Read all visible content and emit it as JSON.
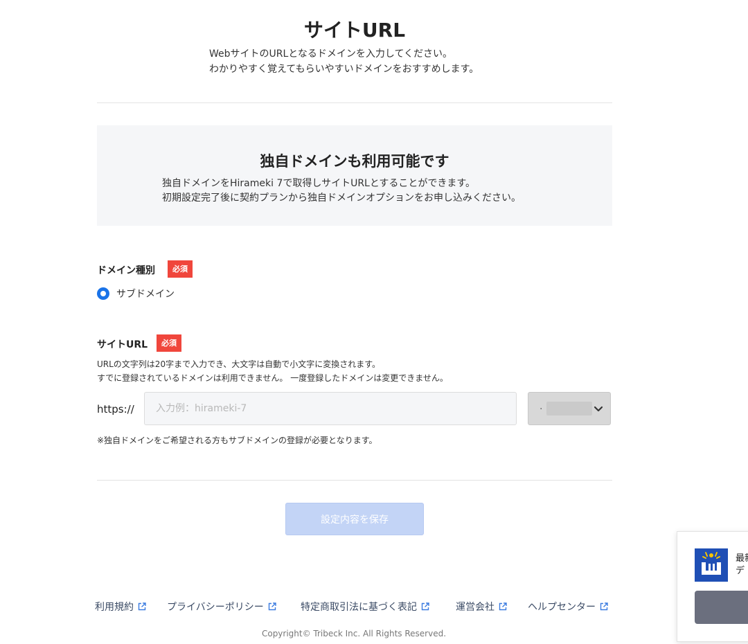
{
  "page": {
    "title": "サイトURL",
    "intro_line1": "WebサイトのURLとなるドメインを入力してください。",
    "intro_line2": "わかりやすく覚えてもらいやすいドメインをおすすめします。"
  },
  "info_box": {
    "title": "独自ドメインも利用可能です",
    "line1": "独自ドメインをHirameki 7で取得しサイトURLとすることができます。",
    "line2": "初期設定完了後に契約プランから独自ドメインオプションをお申し込みください。"
  },
  "domain_type": {
    "label": "ドメイン種別",
    "required": "必須",
    "option": "サブドメイン"
  },
  "site_url": {
    "label": "サイトURL",
    "required": "必須",
    "help1": "URLの文字列は20字まで入力でき、大文字は自動で小文字に変換されます。",
    "help2": "すでに登録されているドメインは利用できません。 一度登録したドメインは変更できません。",
    "prefix": "https://",
    "placeholder": "入力例：hirameki-7",
    "value": "",
    "select_value": ".",
    "note": "※独自ドメインをご希望される方もサブドメインの登録が必要となります。"
  },
  "actions": {
    "save_label": "設定内容を保存"
  },
  "footer": {
    "links": [
      "利用規約",
      "プライバシーポリシー",
      "特定商取引法に基づく表記",
      "運営会社",
      "ヘルプセンター"
    ],
    "copyright": "Copyright© Tribeck Inc. All Rights Reserved."
  },
  "widget": {
    "text_line1": "最新",
    "text_line2": "デ"
  },
  "colors": {
    "required_badge": "#f0463c",
    "radio_accent": "#1a73e8",
    "save_button": "#c3d4f6",
    "info_box_bg": "#f5f6f8",
    "widget_logo": "#1f4fb5"
  },
  "icons": {
    "external_link": "external-link-icon",
    "select_chevron": "chevron-down-icon",
    "widget_logo": "brand-logo-icon"
  }
}
